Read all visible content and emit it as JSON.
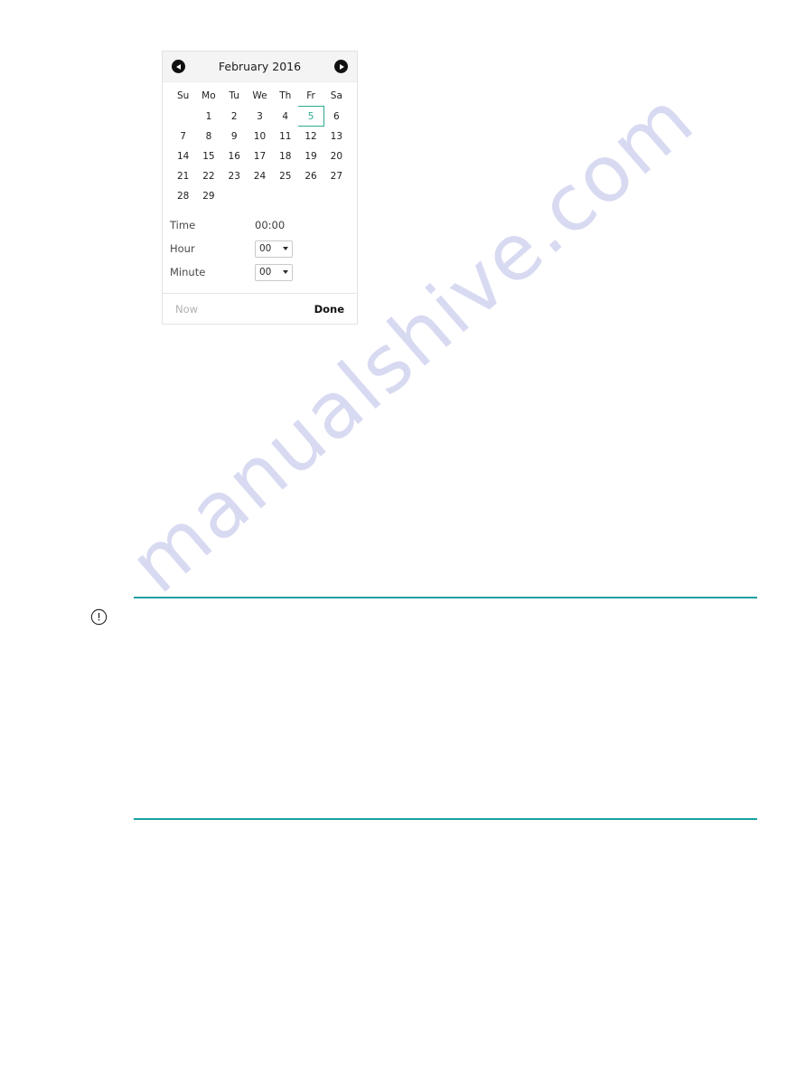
{
  "watermark": {
    "text": "manualshive.com"
  },
  "picker": {
    "header": {
      "prev_label": "prev-month",
      "title": "February 2016",
      "next_label": "next-month",
      "prev_icon": "caret-left-circle-icon",
      "next_icon": "caret-right-circle-icon"
    },
    "weekdays": [
      "Su",
      "Mo",
      "Tu",
      "We",
      "Th",
      "Fr",
      "Sa"
    ],
    "weeks": [
      [
        "",
        "1",
        "2",
        "3",
        "4",
        "5",
        "6"
      ],
      [
        "7",
        "8",
        "9",
        "10",
        "11",
        "12",
        "13"
      ],
      [
        "14",
        "15",
        "16",
        "17",
        "18",
        "19",
        "20"
      ],
      [
        "21",
        "22",
        "23",
        "24",
        "25",
        "26",
        "27"
      ],
      [
        "28",
        "29",
        "",
        "",
        "",
        "",
        ""
      ]
    ],
    "selected_day": "5",
    "selected_color": "#2ea88e",
    "time": {
      "time_label": "Time",
      "time_value": "00:00",
      "hour_label": "Hour",
      "hour_value": "00",
      "minute_label": "Minute",
      "minute_value": "00"
    },
    "footer": {
      "now_label": "Now",
      "done_label": "Done"
    }
  },
  "note": {
    "icon": "exclamation-circle-icon",
    "rule_color": "#1aa0a0"
  }
}
